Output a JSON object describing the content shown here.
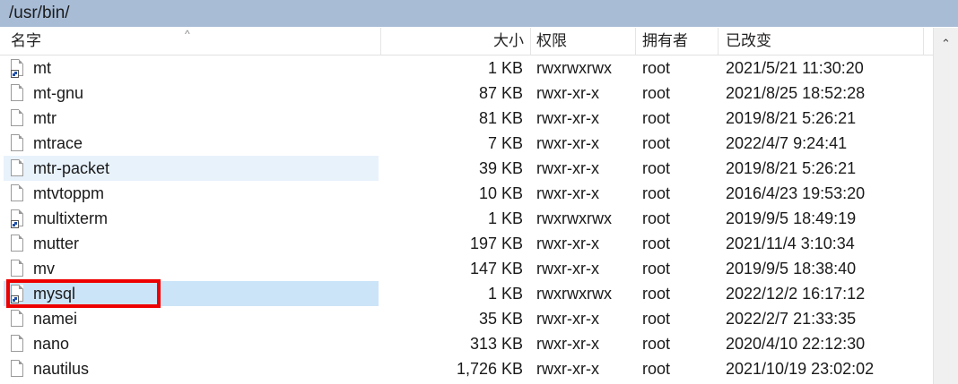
{
  "path": "/usr/bin/",
  "columns": {
    "name": "名字",
    "size": "大小",
    "permissions": "权限",
    "owner": "拥有者",
    "modified": "已改变"
  },
  "files": [
    {
      "name": "mt",
      "size": "1 KB",
      "permissions": "rwxrwxrwx",
      "owner": "root",
      "modified": "2021/5/21 11:30:20",
      "type": "symlink"
    },
    {
      "name": "mt-gnu",
      "size": "87 KB",
      "permissions": "rwxr-xr-x",
      "owner": "root",
      "modified": "2021/8/25 18:52:28",
      "type": "file"
    },
    {
      "name": "mtr",
      "size": "81 KB",
      "permissions": "rwxr-xr-x",
      "owner": "root",
      "modified": "2019/8/21 5:26:21",
      "type": "file"
    },
    {
      "name": "mtrace",
      "size": "7 KB",
      "permissions": "rwxr-xr-x",
      "owner": "root",
      "modified": "2022/4/7 9:24:41",
      "type": "file"
    },
    {
      "name": "mtr-packet",
      "size": "39 KB",
      "permissions": "rwxr-xr-x",
      "owner": "root",
      "modified": "2019/8/21 5:26:21",
      "type": "file",
      "state": "hover"
    },
    {
      "name": "mtvtoppm",
      "size": "10 KB",
      "permissions": "rwxr-xr-x",
      "owner": "root",
      "modified": "2016/4/23 19:53:20",
      "type": "file"
    },
    {
      "name": "multixterm",
      "size": "1 KB",
      "permissions": "rwxrwxrwx",
      "owner": "root",
      "modified": "2019/9/5 18:49:19",
      "type": "symlink"
    },
    {
      "name": "mutter",
      "size": "197 KB",
      "permissions": "rwxr-xr-x",
      "owner": "root",
      "modified": "2021/11/4 3:10:34",
      "type": "file"
    },
    {
      "name": "mv",
      "size": "147 KB",
      "permissions": "rwxr-xr-x",
      "owner": "root",
      "modified": "2019/9/5 18:38:40",
      "type": "file"
    },
    {
      "name": "mysql",
      "size": "1 KB",
      "permissions": "rwxrwxrwx",
      "owner": "root",
      "modified": "2022/12/2 16:17:12",
      "type": "symlink",
      "state": "selected"
    },
    {
      "name": "namei",
      "size": "35 KB",
      "permissions": "rwxr-xr-x",
      "owner": "root",
      "modified": "2022/2/7 21:33:35",
      "type": "file"
    },
    {
      "name": "nano",
      "size": "313 KB",
      "permissions": "rwxr-xr-x",
      "owner": "root",
      "modified": "2020/4/10 22:12:30",
      "type": "file"
    },
    {
      "name": "nautilus",
      "size": "1,726 KB",
      "permissions": "rwxr-xr-x",
      "owner": "root",
      "modified": "2021/10/19 23:02:02",
      "type": "file"
    }
  ],
  "icons": {
    "file": "file-icon",
    "symlink": "symlink-file-icon",
    "sort": "sort-ascending-icon",
    "scroll_up": "scroll-up-arrow-icon"
  },
  "colors": {
    "pathbar": "#a8bcd6",
    "hover_row": "#e8f2fb",
    "selected_row": "#cce4f7",
    "annotation_box": "#ee0000"
  }
}
